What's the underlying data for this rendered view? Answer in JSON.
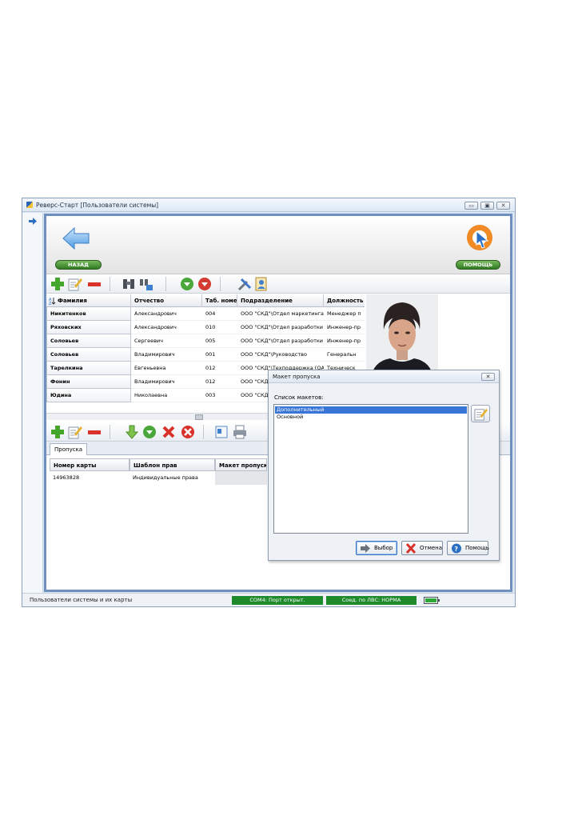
{
  "window": {
    "title": "Реверс-Старт  [Пользователи системы]",
    "controls": {
      "minimize": "▭",
      "maximize": "▣",
      "close": "✕"
    }
  },
  "header": {
    "back_label": "НАЗАД",
    "help_label": "ПОМОЩЬ"
  },
  "users_table": {
    "columns": [
      "Фамилия",
      "Отчество",
      "Таб. номер",
      "Подразделение",
      "Должность"
    ],
    "rows": [
      [
        "Никитенков",
        "Александрович",
        "004",
        "ООО \"СКД\"\\Отдел маркетинга",
        "Менеджер п"
      ],
      [
        "Ряховских",
        "Александрович",
        "010",
        "ООО \"СКД\"\\Отдел разработки",
        "Инженер-пр"
      ],
      [
        "Соловьев",
        "Сергеевич",
        "005",
        "ООО \"СКД\"\\Отдел разработки",
        "Инженер-пр"
      ],
      [
        "Соловьев",
        "Владимирович",
        "001",
        "ООО \"СКД\"\\Руководство",
        "Генеральн"
      ],
      [
        "Тарелкина",
        "Евгеньевна",
        "012",
        "ООО \"СКД\"\\Техподдержка (QA)",
        "Техническ"
      ],
      [
        "Фонин",
        "Владимирович",
        "012",
        "ООО \"СКД\"\\Отдел разработки",
        "Инженер-пр"
      ],
      [
        "Юдина",
        "Николаевна",
        "003",
        "ООО \"СКД\"\\Отдел разработки",
        "Инженер-пр"
      ]
    ]
  },
  "tabs": {
    "active": "Пропуска"
  },
  "cards_table": {
    "columns": [
      "Номер карты",
      "Шаблон прав",
      "Макет пропуска"
    ],
    "rows": [
      [
        "14963828",
        "Индивидуальные права",
        ""
      ]
    ]
  },
  "status": {
    "text": "Пользователи системы и их карты",
    "com": "COM4: Порт открыт.",
    "lan": "Соед. по ЛВС: НОРМА"
  },
  "dialog": {
    "title": "Макет пропуска",
    "close": "✕",
    "list_label": "Список макетов:",
    "items": [
      "Дополнительный",
      "Основной"
    ],
    "selected_index": 0,
    "buttons": {
      "select": "Выбор",
      "cancel": "Отмена",
      "help": "Помощь"
    }
  },
  "colors": {
    "accent_green": "#1f8a2c",
    "selection_blue": "#3875d7",
    "frame_blue": "#6f8fbf"
  }
}
